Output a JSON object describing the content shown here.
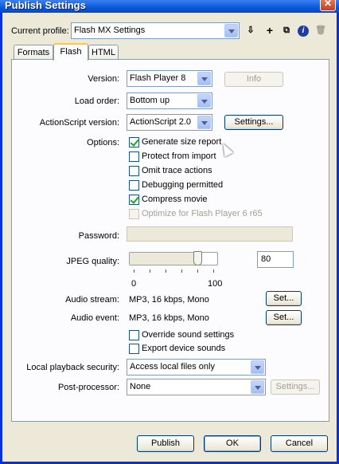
{
  "window": {
    "title": "Publish Settings",
    "close_glyph": "✕"
  },
  "profile": {
    "label": "Current profile:",
    "value": "Flash MX Settings",
    "tools": [
      {
        "name": "import-export-icon",
        "glyph": "⇩"
      },
      {
        "name": "add-profile-icon",
        "glyph": "+"
      },
      {
        "name": "duplicate-profile-icon",
        "glyph": "⧉"
      },
      {
        "name": "profile-info-icon",
        "glyph": "i"
      },
      {
        "name": "delete-profile-icon",
        "glyph": "🗑"
      }
    ]
  },
  "tabs": [
    {
      "label": "Formats"
    },
    {
      "label": "Flash"
    },
    {
      "label": "HTML"
    }
  ],
  "flash": {
    "version": {
      "label": "Version:",
      "value": "Flash Player 8",
      "info_button": "Info"
    },
    "load_order": {
      "label": "Load order:",
      "value": "Bottom up"
    },
    "actionscript": {
      "label": "ActionScript version:",
      "value": "ActionScript 2.0",
      "settings_button": "Settings..."
    },
    "options": {
      "label": "Options:",
      "items": [
        {
          "label": "Generate size report",
          "checked": true,
          "disabled": false
        },
        {
          "label": "Protect from import",
          "checked": false,
          "disabled": false
        },
        {
          "label": "Omit trace actions",
          "checked": false,
          "disabled": false
        },
        {
          "label": "Debugging permitted",
          "checked": false,
          "disabled": false
        },
        {
          "label": "Compress movie",
          "checked": true,
          "disabled": false
        },
        {
          "label": "Optimize for Flash Player 6 r65",
          "checked": false,
          "disabled": true
        }
      ]
    },
    "password": {
      "label": "Password:",
      "value": ""
    },
    "jpeg": {
      "label": "JPEG quality:",
      "value": "80",
      "min_label": "0",
      "max_label": "100",
      "level": 0.8
    },
    "audio_stream": {
      "label": "Audio stream:",
      "value": "MP3, 16 kbps, Mono",
      "set_button": "Set..."
    },
    "audio_event": {
      "label": "Audio event:",
      "value": "MP3, 16 kbps, Mono",
      "set_button": "Set..."
    },
    "sound_options": [
      {
        "label": "Override sound settings",
        "checked": false
      },
      {
        "label": "Export device sounds",
        "checked": false
      }
    ],
    "playback_security": {
      "label": "Local playback security:",
      "value": "Access local files only"
    },
    "post_processor": {
      "label": "Post-processor:",
      "value": "None",
      "settings_button": "Settings..."
    }
  },
  "footer": {
    "publish": "Publish",
    "ok": "OK",
    "cancel": "Cancel"
  }
}
